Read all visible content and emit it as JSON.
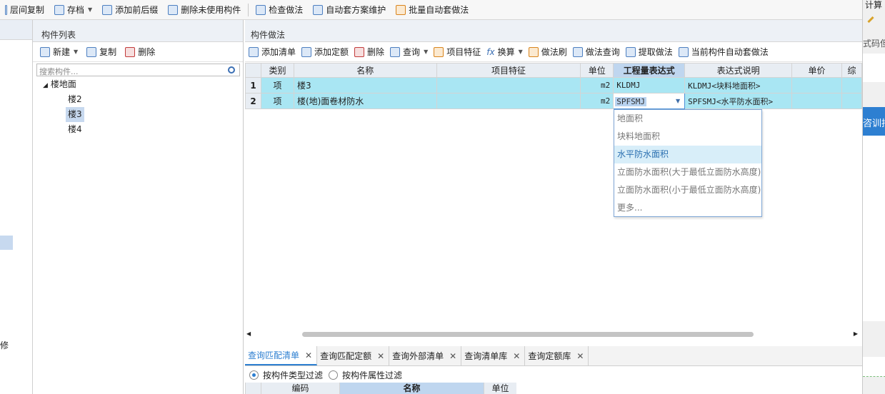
{
  "top_toolbar": {
    "items": [
      "层间复制",
      "存档",
      "添加前后缀",
      "删除未使用构件",
      "检查做法",
      "自动套方案维护",
      "批量自动套做法"
    ]
  },
  "right_strip": {
    "title": "计算",
    "line2": "式码但大",
    "blue_label": "咨训抵"
  },
  "left_strip": {
    "label": "修"
  },
  "component_list": {
    "title": "构件列表",
    "toolbar": {
      "new": "新建",
      "copy": "复制",
      "delete": "删除"
    },
    "search_placeholder": "搜索构件...",
    "tree": {
      "root": "楼地面",
      "children": [
        "楼2",
        "楼3",
        "楼4"
      ],
      "selected": "楼3"
    }
  },
  "method_panel": {
    "title": "构件做法",
    "toolbar": [
      "添加清单",
      "添加定额",
      "删除",
      "查询",
      "项目特征",
      "换算",
      "做法刷",
      "做法查询",
      "提取做法",
      "当前构件自动套做法"
    ],
    "columns": [
      "类别",
      "名称",
      "项目特征",
      "单位",
      "工程量表达式",
      "表达式说明",
      "单价",
      "综"
    ],
    "rows": [
      {
        "num": "1",
        "category": "项",
        "name": "楼3",
        "feature": "",
        "unit": "m2",
        "expr": "KLDMJ",
        "expr_desc": "KLDMJ<块料地面积>",
        "price": ""
      },
      {
        "num": "2",
        "category": "项",
        "name": "楼(地)面卷材防水",
        "feature": "",
        "unit": "m2",
        "expr": "SPFSMJ",
        "expr_desc": "SPFSMJ<水平防水面积>",
        "price": ""
      }
    ],
    "dropdown_options": [
      "地面积",
      "块料地面积",
      "水平防水面积",
      "立面防水面积(大于最低立面防水高度)",
      "立面防水面积(小于最低立面防水高度)",
      "更多..."
    ],
    "dropdown_selected": "水平防水面积"
  },
  "bottom": {
    "tabs": [
      "查询匹配清单",
      "查询匹配定额",
      "查询外部清单",
      "查询清单库",
      "查询定额库"
    ],
    "active_tab": "查询匹配清单",
    "filters": [
      "按构件类型过滤",
      "按构件属性过滤"
    ],
    "columns": [
      "编码",
      "名称",
      "单位"
    ]
  }
}
